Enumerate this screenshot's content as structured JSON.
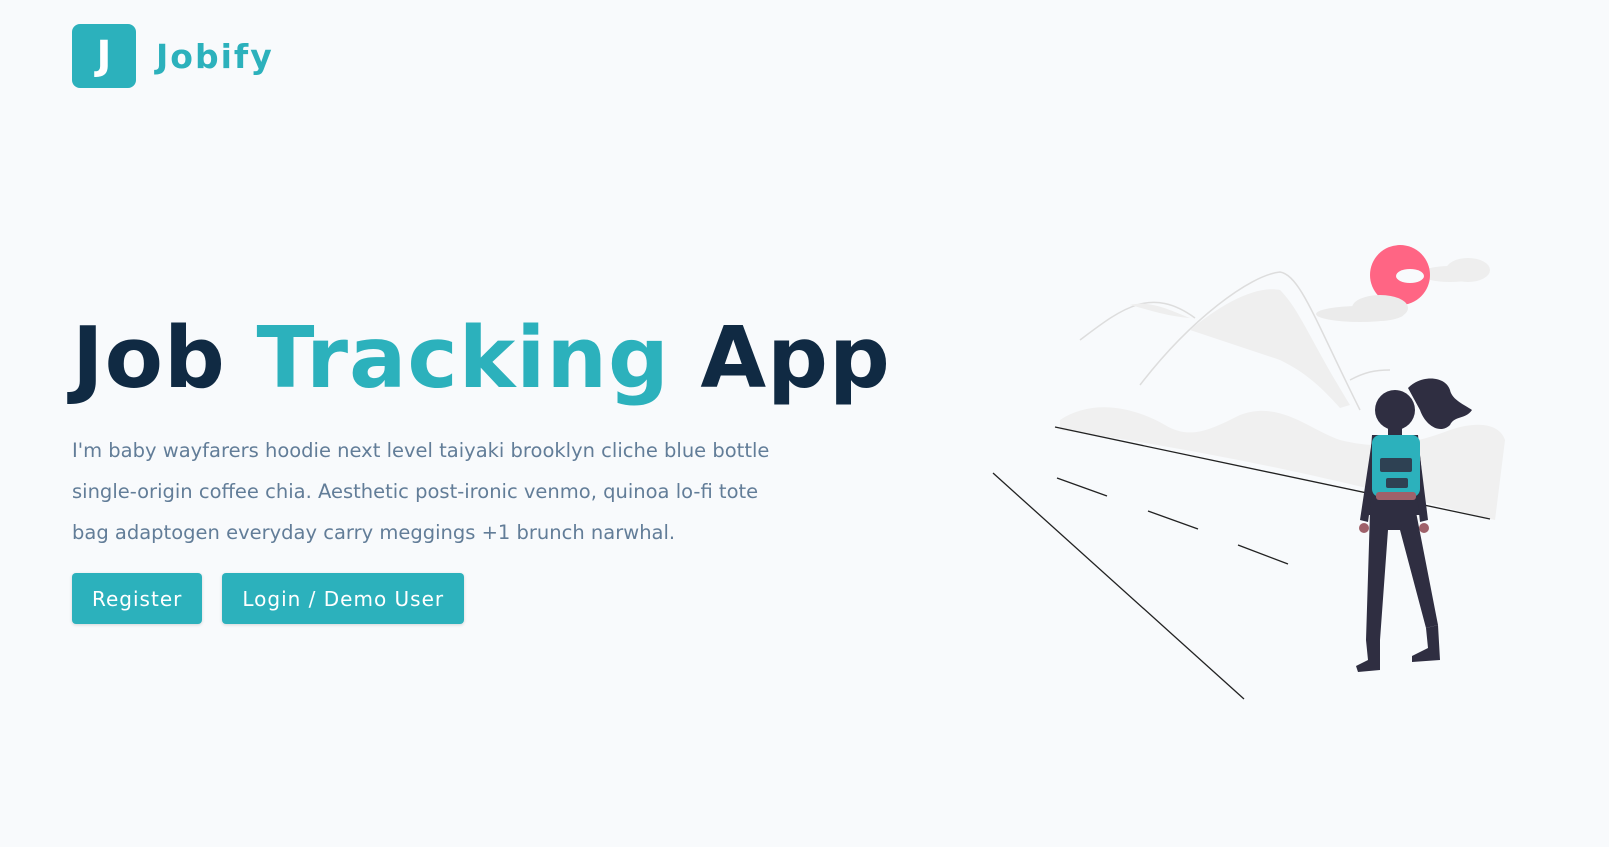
{
  "nav": {
    "logo_letter": "J",
    "brand_name": "Jobify"
  },
  "hero": {
    "title_part1": "Job ",
    "title_accent": "Tracking",
    "title_part2": " App",
    "description": "I'm baby wayfarers hoodie next level taiyaki brooklyn cliche blue bottle single-origin coffee chia. Aesthetic post-ironic venmo, quinoa lo-fi tote bag adaptogen everyday carry meggings +1 brunch narwhal.",
    "register_label": "Register",
    "login_label": "Login / Demo User"
  },
  "colors": {
    "primary": "#2cb1bc",
    "heading": "#102a43",
    "body_text": "#627d98",
    "background": "#f8fafc",
    "sun": "#ff6584",
    "figure": "#2f2e41"
  },
  "icons": {
    "logo": "letter-j-logo-icon",
    "illustration": "hiker-with-backpack-illustration"
  }
}
